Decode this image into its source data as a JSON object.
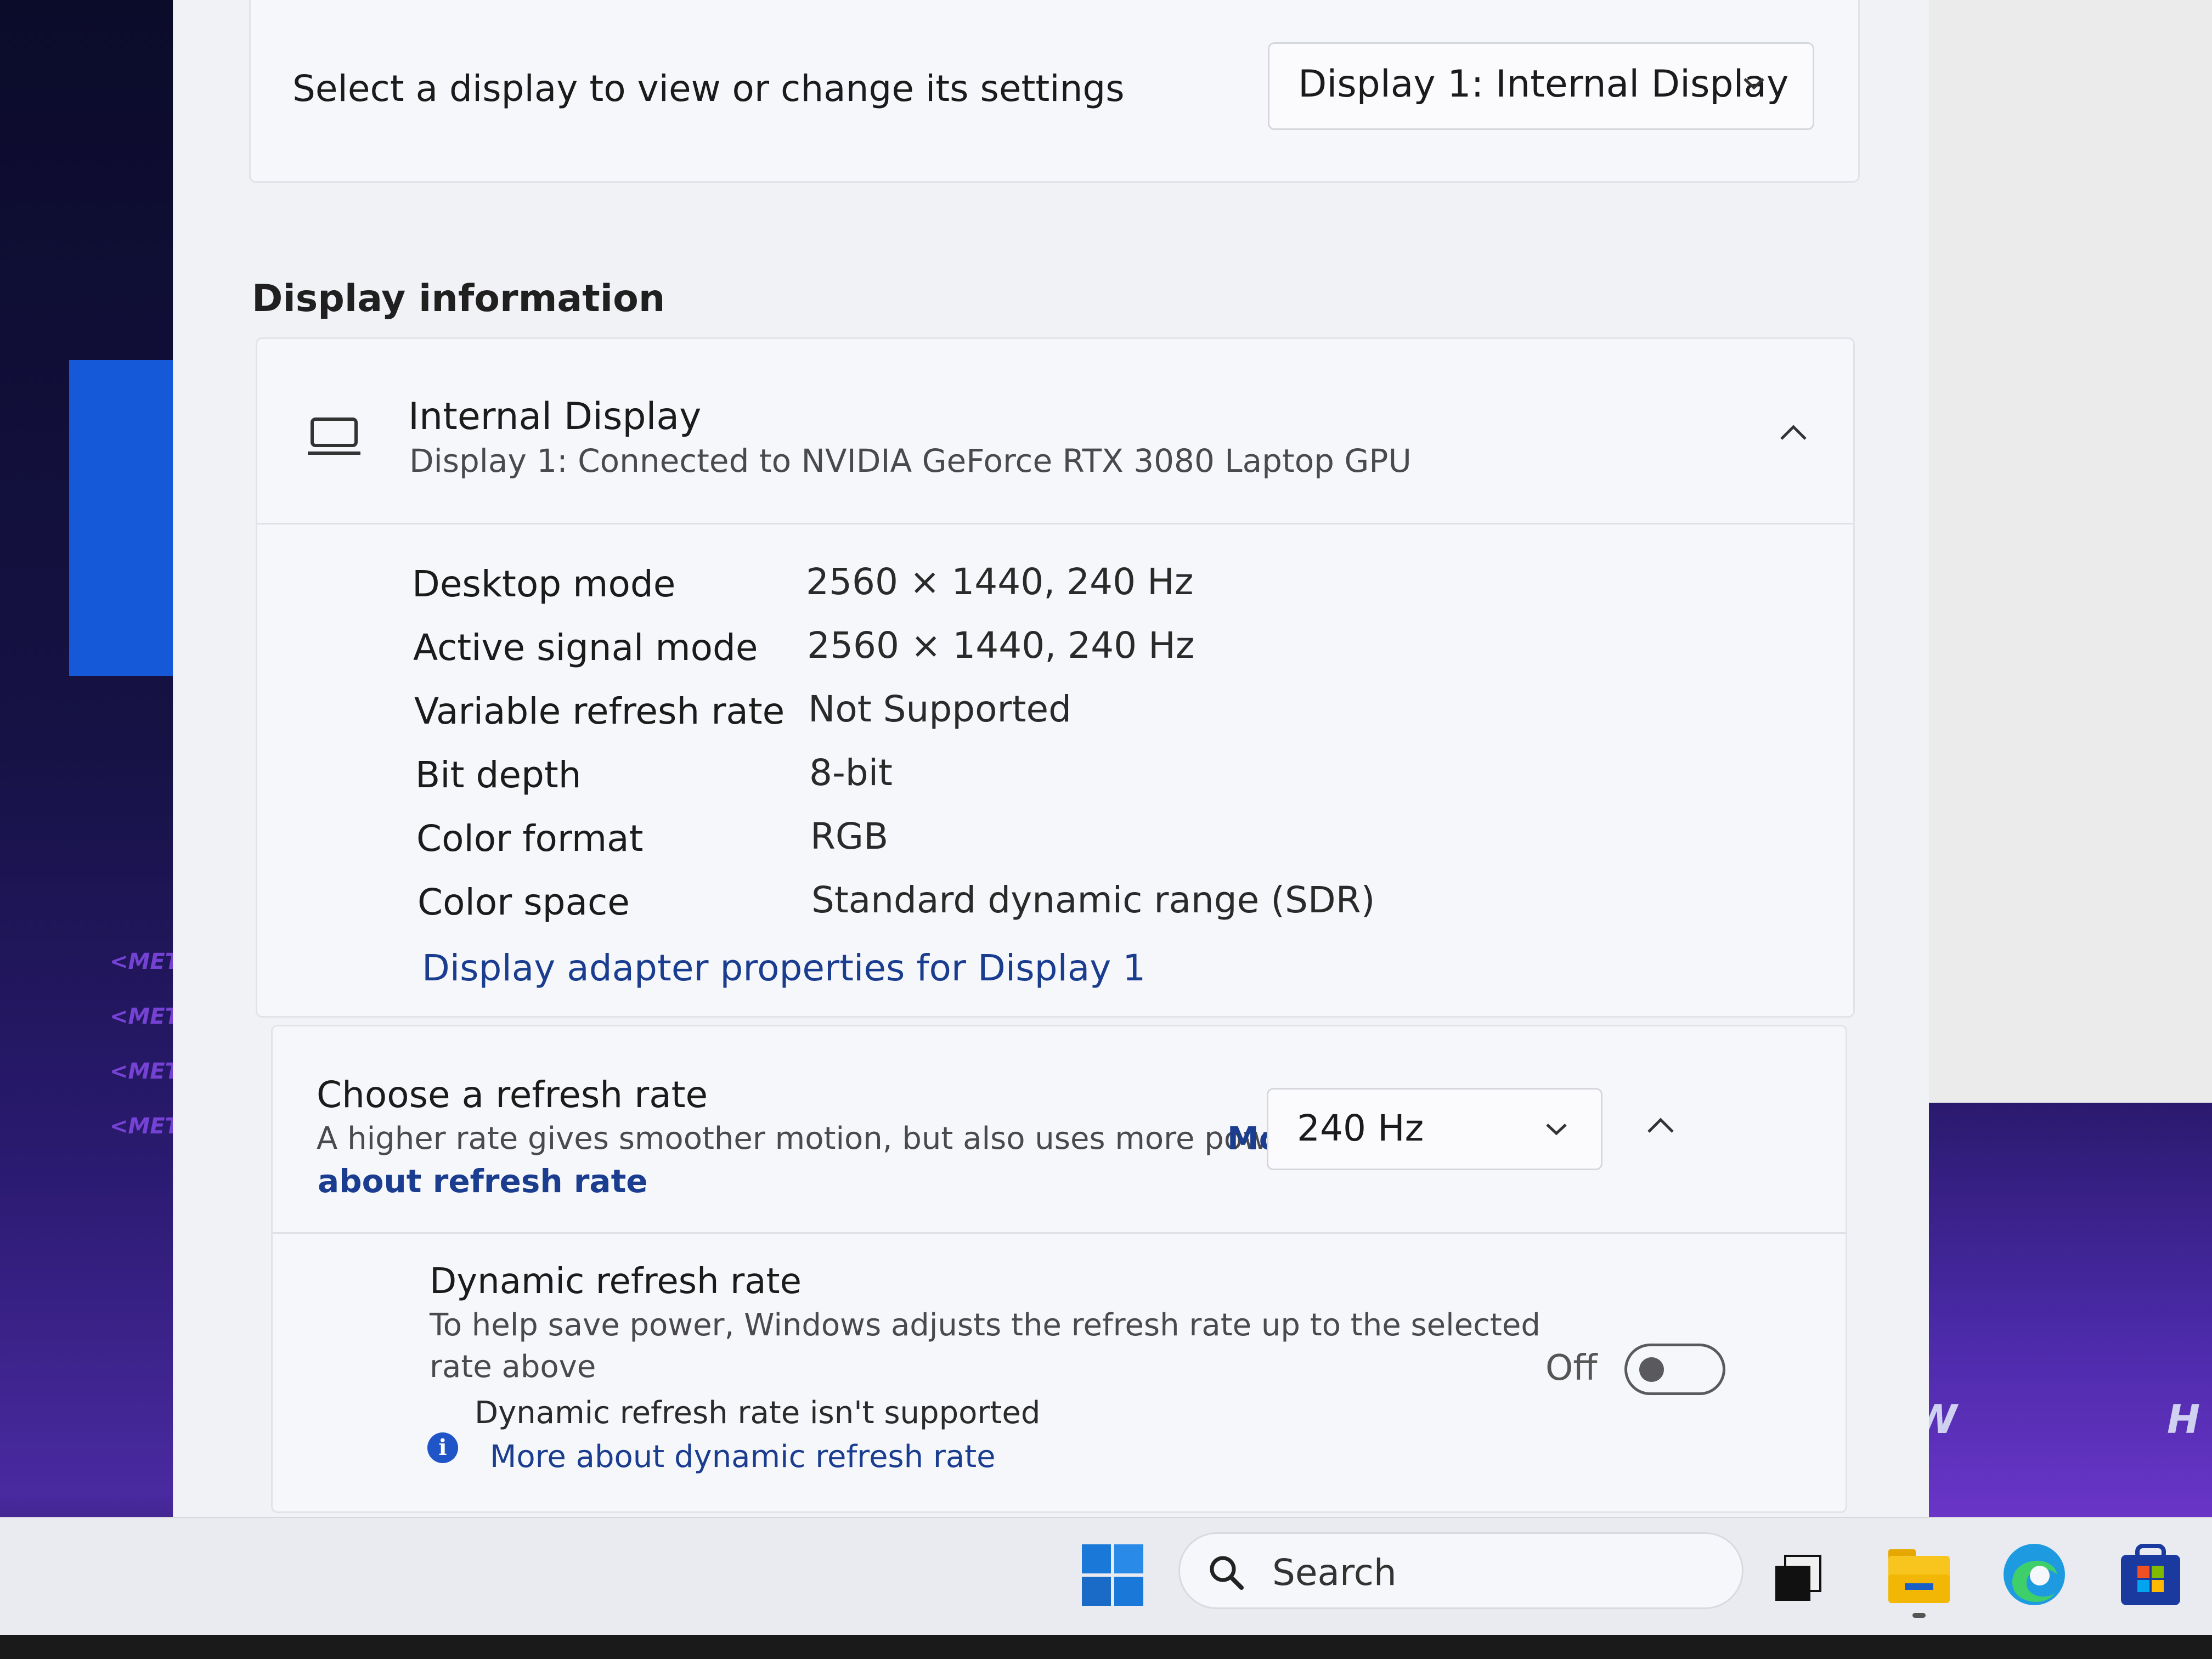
{
  "display_select": {
    "label": "Select a display to view or change its settings",
    "selected": "Display 1: Internal Display"
  },
  "display_information": {
    "heading": "Display information",
    "name": "Internal Display",
    "connection": "Display 1: Connected to NVIDIA GeForce RTX 3080 Laptop GPU",
    "rows": [
      {
        "label": "Desktop mode",
        "value": "2560 × 1440, 240 Hz"
      },
      {
        "label": "Active signal mode",
        "value": "2560 × 1440, 240 Hz"
      },
      {
        "label": "Variable refresh rate",
        "value": "Not Supported"
      },
      {
        "label": "Bit depth",
        "value": "8-bit"
      },
      {
        "label": "Color format",
        "value": "RGB"
      },
      {
        "label": "Color space",
        "value": "Standard dynamic range (SDR)"
      }
    ],
    "adapter_link": "Display adapter properties for Display 1"
  },
  "refresh_rate": {
    "title": "Choose a refresh rate",
    "description": "A higher rate gives smoother motion, but also uses more power",
    "link_part1": "More",
    "link_part2": "about refresh rate",
    "selected": "240 Hz"
  },
  "dynamic_refresh": {
    "title": "Dynamic refresh rate",
    "description_line1": "To help save power, Windows adjusts the refresh rate up to the selected",
    "description_line2": "rate above",
    "toggle_label": "Off",
    "toggle_on": false,
    "notice": "Dynamic refresh rate isn't supported",
    "notice_link": "More about dynamic refresh rate"
  },
  "taskbar": {
    "search_placeholder": "Search"
  },
  "background": {
    "glyphs": [
      "W",
      "H"
    ],
    "meta_tags": [
      "<META",
      "<META",
      "<META",
      "<META"
    ]
  },
  "colors": {
    "accent_link": "#1a3d8f",
    "info_icon": "#1f55c7",
    "windows_logo": "#1a78d8"
  }
}
